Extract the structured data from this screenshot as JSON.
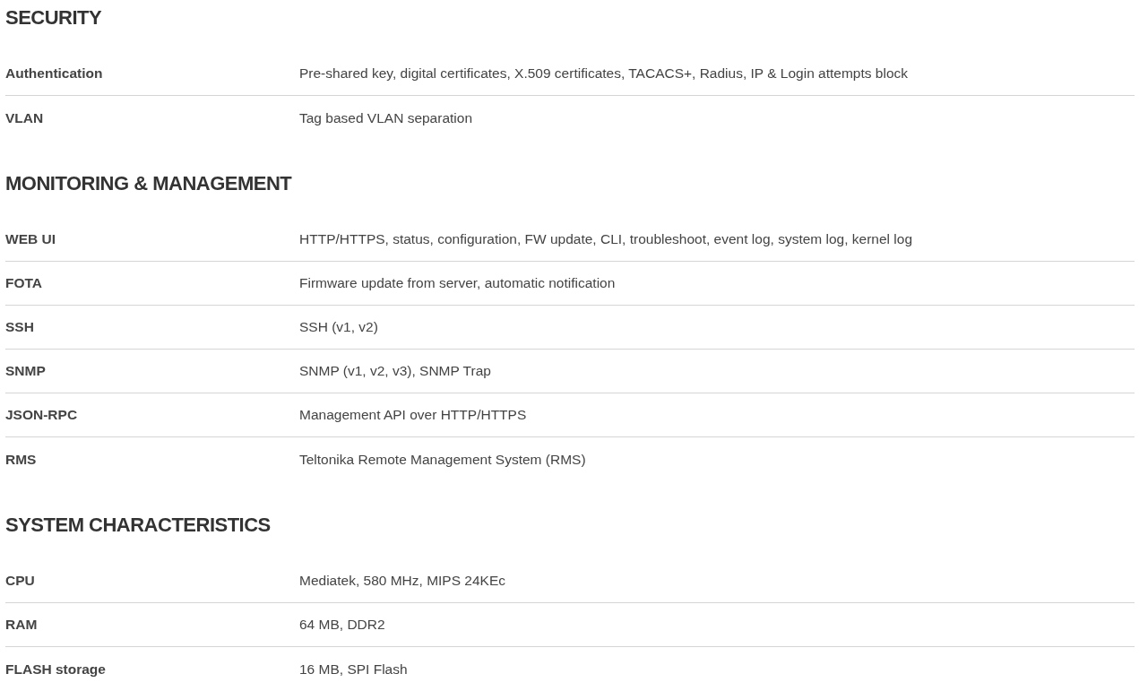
{
  "sections": [
    {
      "title": "SECURITY",
      "rows": [
        {
          "label": "Authentication",
          "value": "Pre-shared key, digital certificates, X.509 certificates, TACACS+, Radius, IP & Login attempts block"
        },
        {
          "label": "VLAN",
          "value": "Tag based VLAN separation"
        }
      ]
    },
    {
      "title": "MONITORING & MANAGEMENT",
      "rows": [
        {
          "label": "WEB UI",
          "value": "HTTP/HTTPS, status, configuration, FW update, CLI, troubleshoot, event log, system log, kernel log"
        },
        {
          "label": "FOTA",
          "value": "Firmware update from server, automatic notification"
        },
        {
          "label": "SSH",
          "value": "SSH (v1, v2)"
        },
        {
          "label": "SNMP",
          "value": "SNMP (v1, v2, v3), SNMP Trap"
        },
        {
          "label": "JSON-RPC",
          "value": "Management API over HTTP/HTTPS"
        },
        {
          "label": "RMS",
          "value": "Teltonika Remote Management System (RMS)"
        }
      ]
    },
    {
      "title": "SYSTEM CHARACTERISTICS",
      "rows": [
        {
          "label": "CPU",
          "value": "Mediatek, 580 MHz, MIPS 24KEc"
        },
        {
          "label": "RAM",
          "value": "64 MB, DDR2"
        },
        {
          "label": "FLASH storage",
          "value": "16 MB, SPI Flash"
        }
      ]
    }
  ]
}
